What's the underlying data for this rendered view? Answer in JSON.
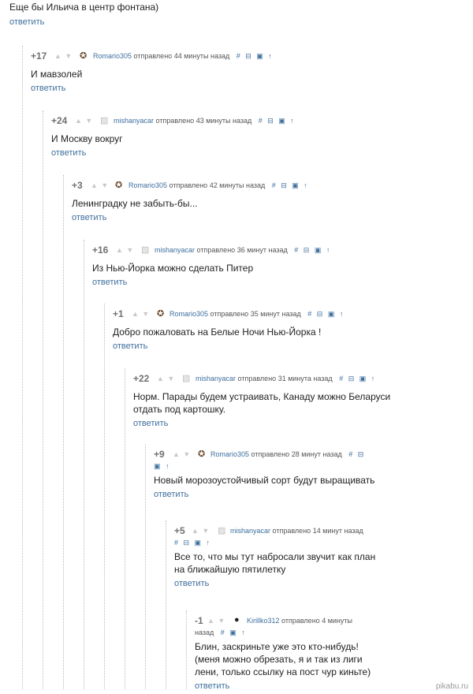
{
  "top": {
    "text": "Еще бы Ильича в центр фонтана)",
    "reply": "ответить"
  },
  "comments": [
    {
      "score": "+17",
      "arrows": "▲ ▼",
      "user": "Romario305",
      "sent": "отправлено",
      "time": "44 минуты назад",
      "actions": "# ⊟ ▣ ↑",
      "text": "И мавзолей",
      "reply": "ответить"
    },
    {
      "score": "+24",
      "arrows": "▲ ▼",
      "user": "mishanyacar",
      "sent": "отправлено",
      "time": "43 минуты назад",
      "actions": "# ⊟ ▣ ↑",
      "text": "И Москву вокруг",
      "reply": "ответить"
    },
    {
      "score": "+3",
      "arrows": "▲ ▼",
      "user": "Romario305",
      "sent": "отправлено",
      "time": "42 минуты назад",
      "actions": "# ⊟ ▣ ↑",
      "text": "Ленинградку не забыть-бы...",
      "reply": "ответить"
    },
    {
      "score": "+16",
      "arrows": "▲ ▼",
      "user": "mishanyacar",
      "sent": "отправлено",
      "time": "36 минут назад",
      "actions": "# ⊟ ▣ ↑",
      "text": "Из Нью-Йорка можно сделать Питер",
      "reply": "ответить"
    },
    {
      "score": "+1",
      "arrows": "▲ ▼",
      "user": "Romario305",
      "sent": "отправлено",
      "time": "35 минут назад",
      "actions": "# ⊟ ▣ ↑",
      "text": "Добро пожаловать на Белые Ночи Нью-Йорка !",
      "reply": "ответить"
    },
    {
      "score": "+22",
      "arrows": "▲ ▼",
      "user": "mishanyacar",
      "sent": "отправлено",
      "time": "31 минута назад",
      "actions": "# ⊟ ▣ ↑",
      "text_line1": "Норм. Парады будем устраивать, Канаду можно Беларуси",
      "text_line2": "отдать под картошку.",
      "reply": "ответить"
    },
    {
      "score": "+9",
      "arrows": "▲ ▼",
      "user": "Romario305",
      "sent": "отправлено",
      "time": "28 минут назад",
      "actions": "# ⊟",
      "actions2": "▣ ↑",
      "text": "Новый морозоустойчивый сорт будут выращивать",
      "reply": "ответить"
    },
    {
      "score": "+5",
      "arrows": "▲ ▼",
      "user": "mishanyacar",
      "sent": "отправлено",
      "time": "14 минут назад",
      "actions2": "# ⊟ ▣ ↑",
      "text_line1": "Все то, что мы тут набросали звучит как план",
      "text_line2": "на ближайшую пятилетку",
      "reply": "ответить"
    },
    {
      "score": "-1",
      "arrows": "▲ ▼",
      "user": "Kirillko312",
      "sent": "отправлено",
      "time": "4 минуты",
      "time2": "назад",
      "actions2": "# ▣ ↑",
      "text_line1": "Блин, заскриньте уже это кто-нибудь!",
      "text_line2": "(меня можно обрезать, я и так из лиги",
      "text_line3": "лени, только ссылку на пост чур киньте)",
      "reply": "ответить"
    }
  ],
  "watermark": "pikabu.ru"
}
